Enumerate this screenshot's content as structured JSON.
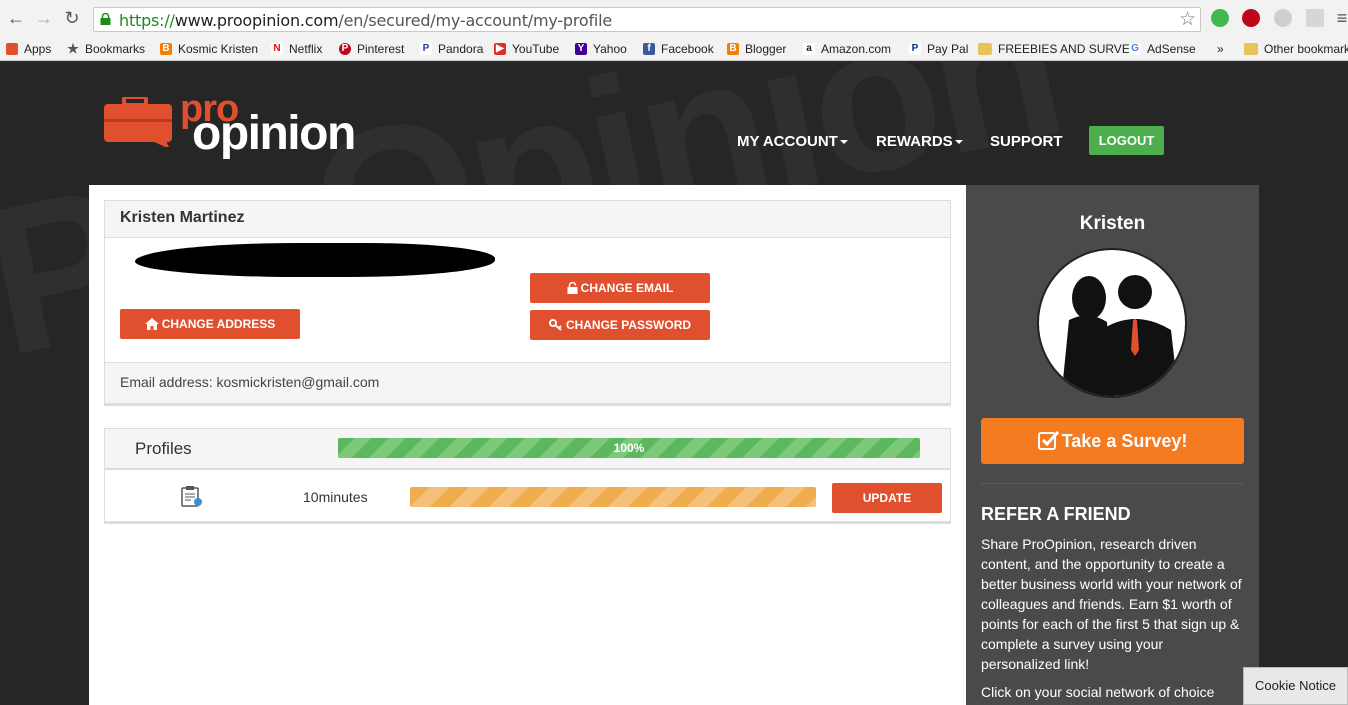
{
  "browser": {
    "url_scheme": "https://",
    "url_host": "www.proopinion.com",
    "url_path": "/en/secured/my-account/my-profile"
  },
  "bookmarks": [
    {
      "label": "Apps",
      "icon": "apps-grid-icon",
      "color": "#e0502f"
    },
    {
      "label": "Bookmarks",
      "icon": "star-icon",
      "color": "#555555"
    },
    {
      "label": "Kosmic Kristen",
      "icon": "blogger-icon",
      "color": "#f57d00"
    },
    {
      "label": "Netflix",
      "icon": "netflix-icon",
      "color": "#e50914"
    },
    {
      "label": "Pinterest",
      "icon": "pinterest-icon",
      "color": "#bd081c"
    },
    {
      "label": "Pandora",
      "icon": "pandora-icon",
      "color": "#224099"
    },
    {
      "label": "YouTube",
      "icon": "youtube-icon",
      "color": "#e52d27"
    },
    {
      "label": "Yahoo",
      "icon": "yahoo-icon",
      "color": "#410093"
    },
    {
      "label": "Facebook",
      "icon": "facebook-icon",
      "color": "#3b5998"
    },
    {
      "label": "Blogger",
      "icon": "blogger-icon",
      "color": "#f57d00"
    },
    {
      "label": "Amazon.com",
      "icon": "amazon-icon",
      "color": "#222222"
    },
    {
      "label": "Pay Pal",
      "icon": "paypal-icon",
      "color": "#003087"
    },
    {
      "label": "FREEBIES AND SURVE",
      "icon": "folder-icon",
      "color": "#e8c35a"
    },
    {
      "label": "AdSense",
      "icon": "google-icon",
      "color": "#4285f4"
    },
    {
      "label": "»",
      "icon": "overflow-icon",
      "color": "#555555"
    },
    {
      "label": "Other bookmark",
      "icon": "folder-icon",
      "color": "#e8c35a"
    }
  ],
  "site": {
    "logo_pro": "pro",
    "logo_opinion": "opinion",
    "nav": {
      "my_account": "MY ACCOUNT",
      "rewards": "REWARDS",
      "support": "SUPPORT",
      "logout": "LOGOUT"
    },
    "accent": "#e0502f"
  },
  "profile": {
    "name": "Kristen Martinez",
    "change_email": "CHANGE EMAIL",
    "change_password": "CHANGE PASSWORD",
    "change_address": "CHANGE ADDRESS",
    "email_line": "Email address: kosmickristen@gmail.com"
  },
  "profiles": {
    "title": "Profiles",
    "progress_label": "100%",
    "progress_value": 1.0,
    "row": {
      "icon": "clipboard-icon",
      "time": "10minutes",
      "progress_value": 1.0,
      "update": "UPDATE"
    }
  },
  "sidebar": {
    "first_name": "Kristen",
    "survey_button": "Take a Survey!",
    "refer_title": "REFER A FRIEND",
    "refer_text": "Share ProOpinion, research driven content, and the opportunity to create a better business world with your network of colleagues and friends. Earn $1 worth of points for each of the first 5 that sign up & complete a survey using your personalized link!",
    "refer_more": "Click on your social network of choice"
  },
  "cookie_notice": "Cookie Notice"
}
